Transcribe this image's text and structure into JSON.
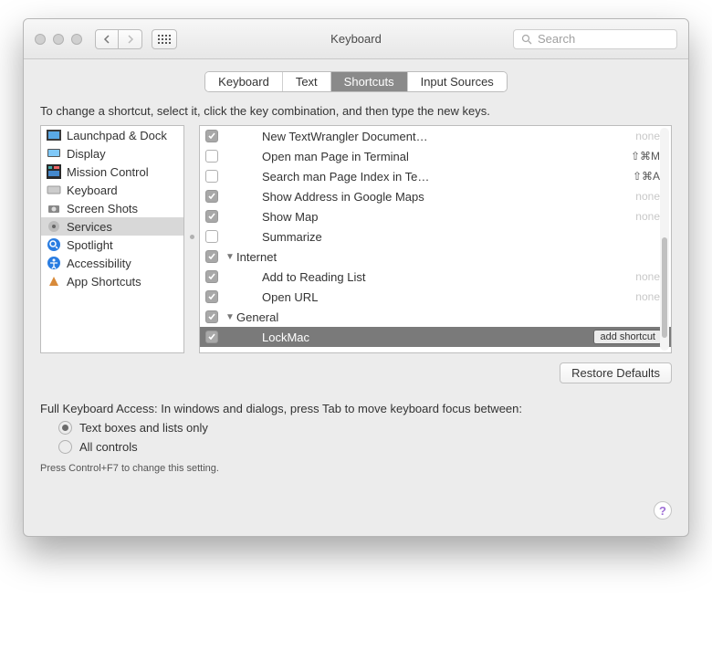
{
  "window": {
    "title": "Keyboard",
    "search_placeholder": "Search"
  },
  "tabs": {
    "keyboard": "Keyboard",
    "text": "Text",
    "shortcuts": "Shortcuts",
    "input_sources": "Input Sources"
  },
  "instruction": "To change a shortcut, select it, click the key combination, and then type the new keys.",
  "sidebar": {
    "items": [
      {
        "label": "Launchpad & Dock"
      },
      {
        "label": "Display"
      },
      {
        "label": "Mission Control"
      },
      {
        "label": "Keyboard"
      },
      {
        "label": "Screen Shots"
      },
      {
        "label": "Services"
      },
      {
        "label": "Spotlight"
      },
      {
        "label": "Accessibility"
      },
      {
        "label": "App Shortcuts"
      }
    ]
  },
  "list": {
    "rows": [
      {
        "label": "New TextWrangler Document…",
        "shortcut": "none",
        "checked": true
      },
      {
        "label": "Open man Page in Terminal",
        "shortcut": "⇧⌘M",
        "checked": false
      },
      {
        "label": "Search man Page Index in Te…",
        "shortcut": "⇧⌘A",
        "checked": false
      },
      {
        "label": "Show Address in Google Maps",
        "shortcut": "none",
        "checked": true
      },
      {
        "label": "Show Map",
        "shortcut": "none",
        "checked": true
      },
      {
        "label": "Summarize",
        "shortcut": "",
        "checked": false
      }
    ],
    "group_internet": "Internet",
    "internet_rows": [
      {
        "label": "Add to Reading List",
        "shortcut": "none",
        "checked": true
      },
      {
        "label": "Open URL",
        "shortcut": "none",
        "checked": true
      }
    ],
    "group_general": "General",
    "lockmac": "LockMac",
    "add_shortcut_label": "add shortcut"
  },
  "restore": "Restore Defaults",
  "fka": {
    "title": "Full Keyboard Access: In windows and dialogs, press Tab to move keyboard focus between:",
    "opt1": "Text boxes and lists only",
    "opt2": "All controls",
    "hint": "Press Control+F7 to change this setting."
  }
}
